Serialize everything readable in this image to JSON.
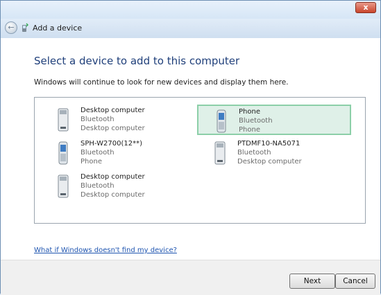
{
  "window": {
    "close_label": "x",
    "header_title": "Add a device"
  },
  "content": {
    "heading": "Select a device to add to this computer",
    "instruction": "Windows will continue to look for new devices and display them here.",
    "devices": [
      {
        "name": "Desktop computer",
        "protocol": "Bluetooth",
        "type": "Desktop computer",
        "icon": "desktop-computer-icon",
        "selected": false
      },
      {
        "name": "Phone",
        "protocol": "Bluetooth",
        "type": "Phone",
        "icon": "phone-icon",
        "selected": true
      },
      {
        "name": "SPH-W2700(12**)",
        "protocol": "Bluetooth",
        "type": "Phone",
        "icon": "phone-icon",
        "selected": false
      },
      {
        "name": "PTDMF10-NA5071",
        "protocol": "Bluetooth",
        "type": "Desktop computer",
        "icon": "desktop-computer-icon",
        "selected": false
      },
      {
        "name": "Desktop computer",
        "protocol": "Bluetooth",
        "type": "Desktop computer",
        "icon": "desktop-computer-icon",
        "selected": false
      }
    ],
    "help_link": "What if Windows doesn't find my device?"
  },
  "footer": {
    "next_label": "Next",
    "cancel_label": "Cancel"
  },
  "colors": {
    "heading": "#1f3f7a",
    "link": "#1f55b0",
    "selection_border": "#8ccfa8",
    "selection_fill": "#dff0e8"
  }
}
